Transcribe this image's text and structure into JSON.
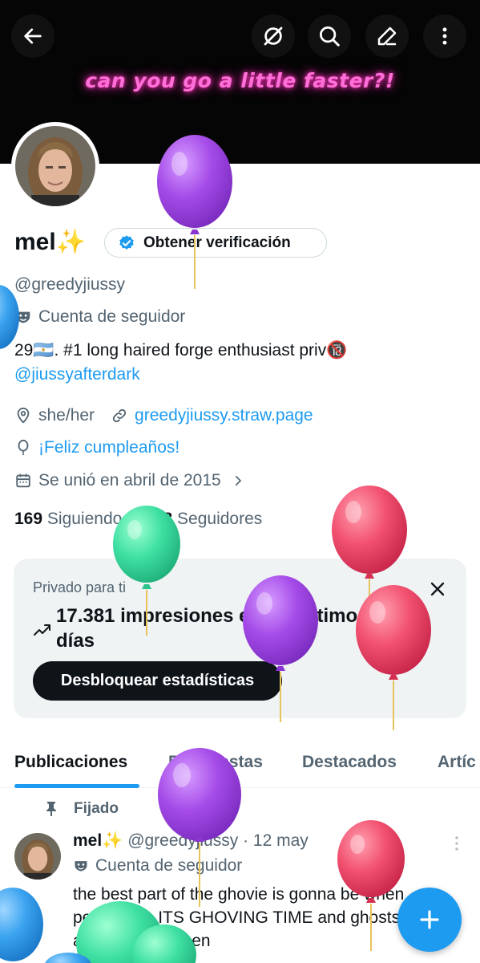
{
  "banner": {
    "text": "can you go a little faster?!"
  },
  "profile": {
    "name": "mel✨",
    "verify_label": "Obtener verificación",
    "handle": "@greedyjiussy",
    "account_type": "Cuenta de seguidor",
    "bio_text": "29🇦🇷. #1 long haired forge enthusiast priv🔞",
    "bio_link": "@jiussyafterdark",
    "pronouns": "she/her",
    "website": "greedyjiussy.straw.page",
    "birthday": "¡Feliz cumpleaños!",
    "joined": "Se unió en abril de 2015",
    "following_count": "169",
    "following_label": "Siguiendo",
    "followers_count": "618",
    "followers_label": "Seguidores"
  },
  "stats_card": {
    "private_label": "Privado para ti",
    "impressions_line1": "17.381 impresiones en los últimos 7",
    "impressions_line2": "días",
    "unlock_label": "Desbloquear estadísticas"
  },
  "tabs": [
    "Publicaciones",
    "Respuestas",
    "Destacados",
    "Artíc"
  ],
  "post": {
    "pinned_label": "Fijado",
    "name": "mel✨",
    "handle": "@greedyjiussy",
    "date": "· 12 may",
    "account_type": "Cuenta de seguidor",
    "text": "the best part of the ghovie is gonna be when percy says ITS GHOVING TIME and ghosts all over the screen"
  },
  "colors": {
    "accent": "#1d9bf0",
    "text": "#0f1419",
    "muted": "#536471",
    "balloon_purple": "#a54be8",
    "balloon_green": "#3fe0a3",
    "balloon_red": "#f2506f",
    "balloon_blue": "#3aa3ef"
  },
  "icons": [
    "back-arrow-icon",
    "hide-icon",
    "search-icon",
    "edit-icon",
    "more-vertical-icon",
    "verified-badge-icon",
    "mask-icon",
    "location-icon",
    "link-icon",
    "balloon-icon",
    "calendar-icon",
    "chevron-right-icon",
    "trend-icon",
    "close-icon",
    "pin-icon",
    "plus-icon"
  ]
}
